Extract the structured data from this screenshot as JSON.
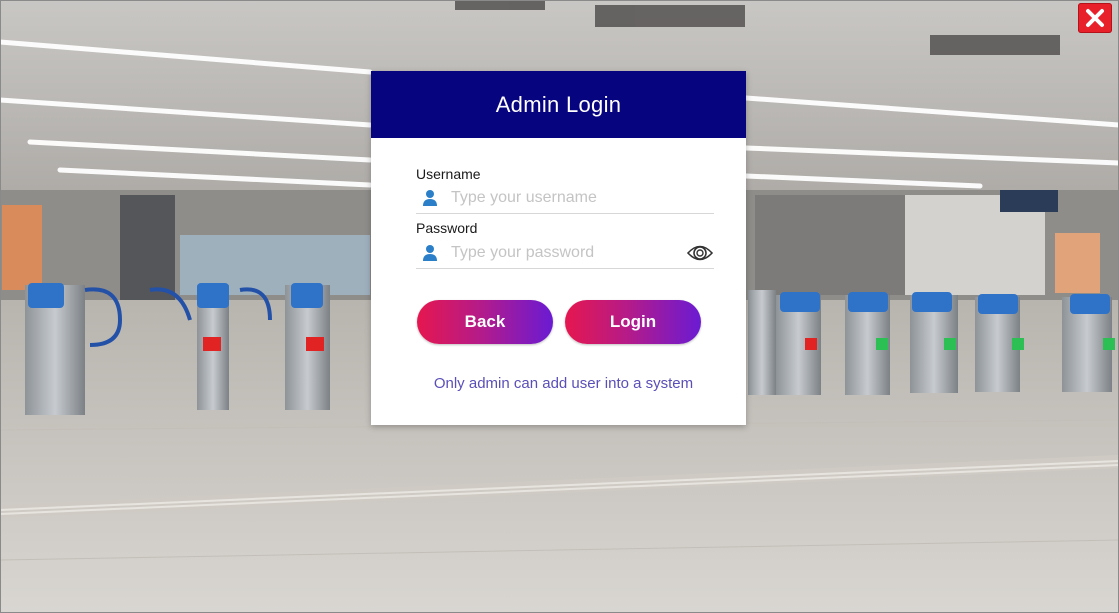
{
  "window": {
    "close_label": "Close"
  },
  "login": {
    "title": "Admin Login",
    "username": {
      "label": "Username",
      "placeholder": "Type your username",
      "value": ""
    },
    "password": {
      "label": "Password",
      "placeholder": "Type your password",
      "value": ""
    },
    "back_label": "Back",
    "login_label": "Login",
    "note": "Only admin can add user into a system"
  },
  "colors": {
    "header": "#07047f",
    "button_gradient": [
      "#e5174f",
      "#6a1bd3"
    ],
    "note_text": "#5a4fb8",
    "close_button": "#e8202a",
    "field_icon": "#2b7fc8"
  },
  "icons": {
    "close": "close-x-icon",
    "username": "user-icon",
    "password": "user-icon",
    "password_toggle": "eye-icon"
  }
}
